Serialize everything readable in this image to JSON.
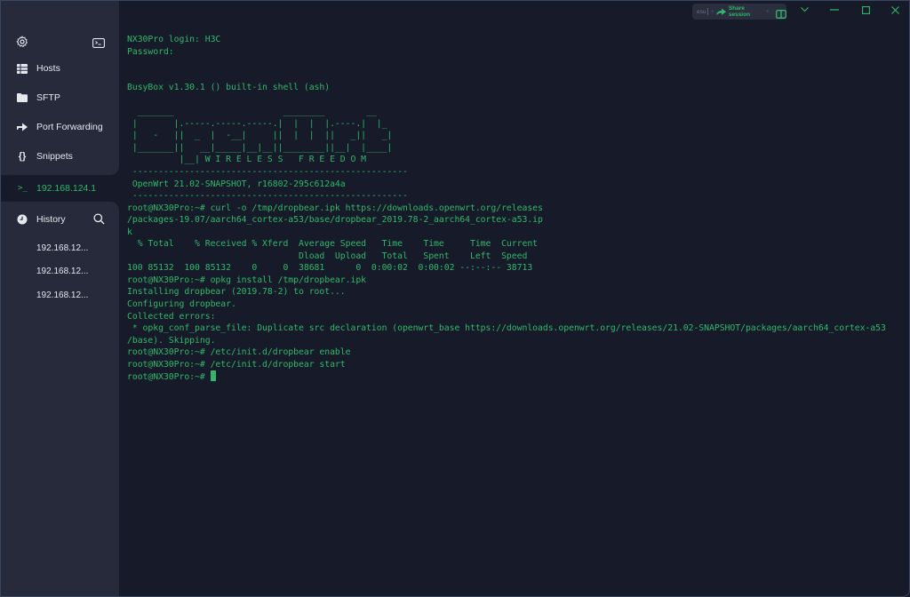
{
  "sidebar": {
    "top_icons": {
      "settings": "gear-icon",
      "new_terminal": "terminal-icon"
    },
    "nav": [
      {
        "label": "Hosts",
        "icon": "hosts-icon"
      },
      {
        "label": "SFTP",
        "icon": "folder-icon"
      },
      {
        "label": "Port Forwarding",
        "icon": "port-forwarding-icon"
      },
      {
        "label": "Snippets",
        "icon": "snippets-icon"
      }
    ],
    "active_session": {
      "prompt": ">_",
      "label": "192.168.124.1"
    },
    "history": {
      "label": "History",
      "items": [
        "192.168.12...",
        "192.168.12...",
        "192.168.12..."
      ]
    }
  },
  "titlebar": {
    "shortcut_hint": "esu",
    "share_label": "Share session"
  },
  "terminal": {
    "lines": [
      "NX30Pro login: H3C",
      "Password:",
      "",
      "",
      "BusyBox v1.30.1 () built-in shell (ash)",
      "",
      "  _______                     ________        __",
      " |       |.-----.-----.-----.|  |  |  |.----.|  |_",
      " |   -   ||  _  |  -__|     ||  |  |  ||   _||   _|",
      " |_______||   __|_____|__|__||________||__|  |____|",
      "          |__| W I R E L E S S   F R E E D O M",
      " -----------------------------------------------------",
      " OpenWrt 21.02-SNAPSHOT, r16802-295c612a4a",
      " -----------------------------------------------------",
      "root@NX30Pro:~# curl -o /tmp/dropbear.ipk https://downloads.openwrt.org/releases",
      "/packages-19.07/aarch64_cortex-a53/base/dropbear_2019.78-2_aarch64_cortex-a53.ip",
      "k",
      "  % Total    % Received % Xferd  Average Speed   Time    Time     Time  Current",
      "                                 Dload  Upload   Total   Spent    Left  Speed",
      "100 85132  100 85132    0     0  38681      0  0:00:02  0:00:02 --:--:-- 38713",
      "root@NX30Pro:~# opkg install /tmp/dropbear.ipk",
      "Installing dropbear (2019.78-2) to root...",
      "Configuring dropbear.",
      "Collected errors:",
      " * opkg_conf_parse_file: Duplicate src declaration (openwrt_base https://downloads.openwrt.org/releases/21.02-SNAPSHOT/packages/aarch64_cortex-a53",
      "/base). Skipping.",
      "root@NX30Pro:~# /etc/init.d/dropbear enable",
      "root@NX30Pro:~# /etc/init.d/dropbear start"
    ],
    "prompt": "root@NX30Pro:~# "
  },
  "colors": {
    "terminal_bg": "#171a28",
    "sidebar_bg": "#272a3b",
    "accent_green": "#2fb86b",
    "text": "#e6e8ee"
  }
}
